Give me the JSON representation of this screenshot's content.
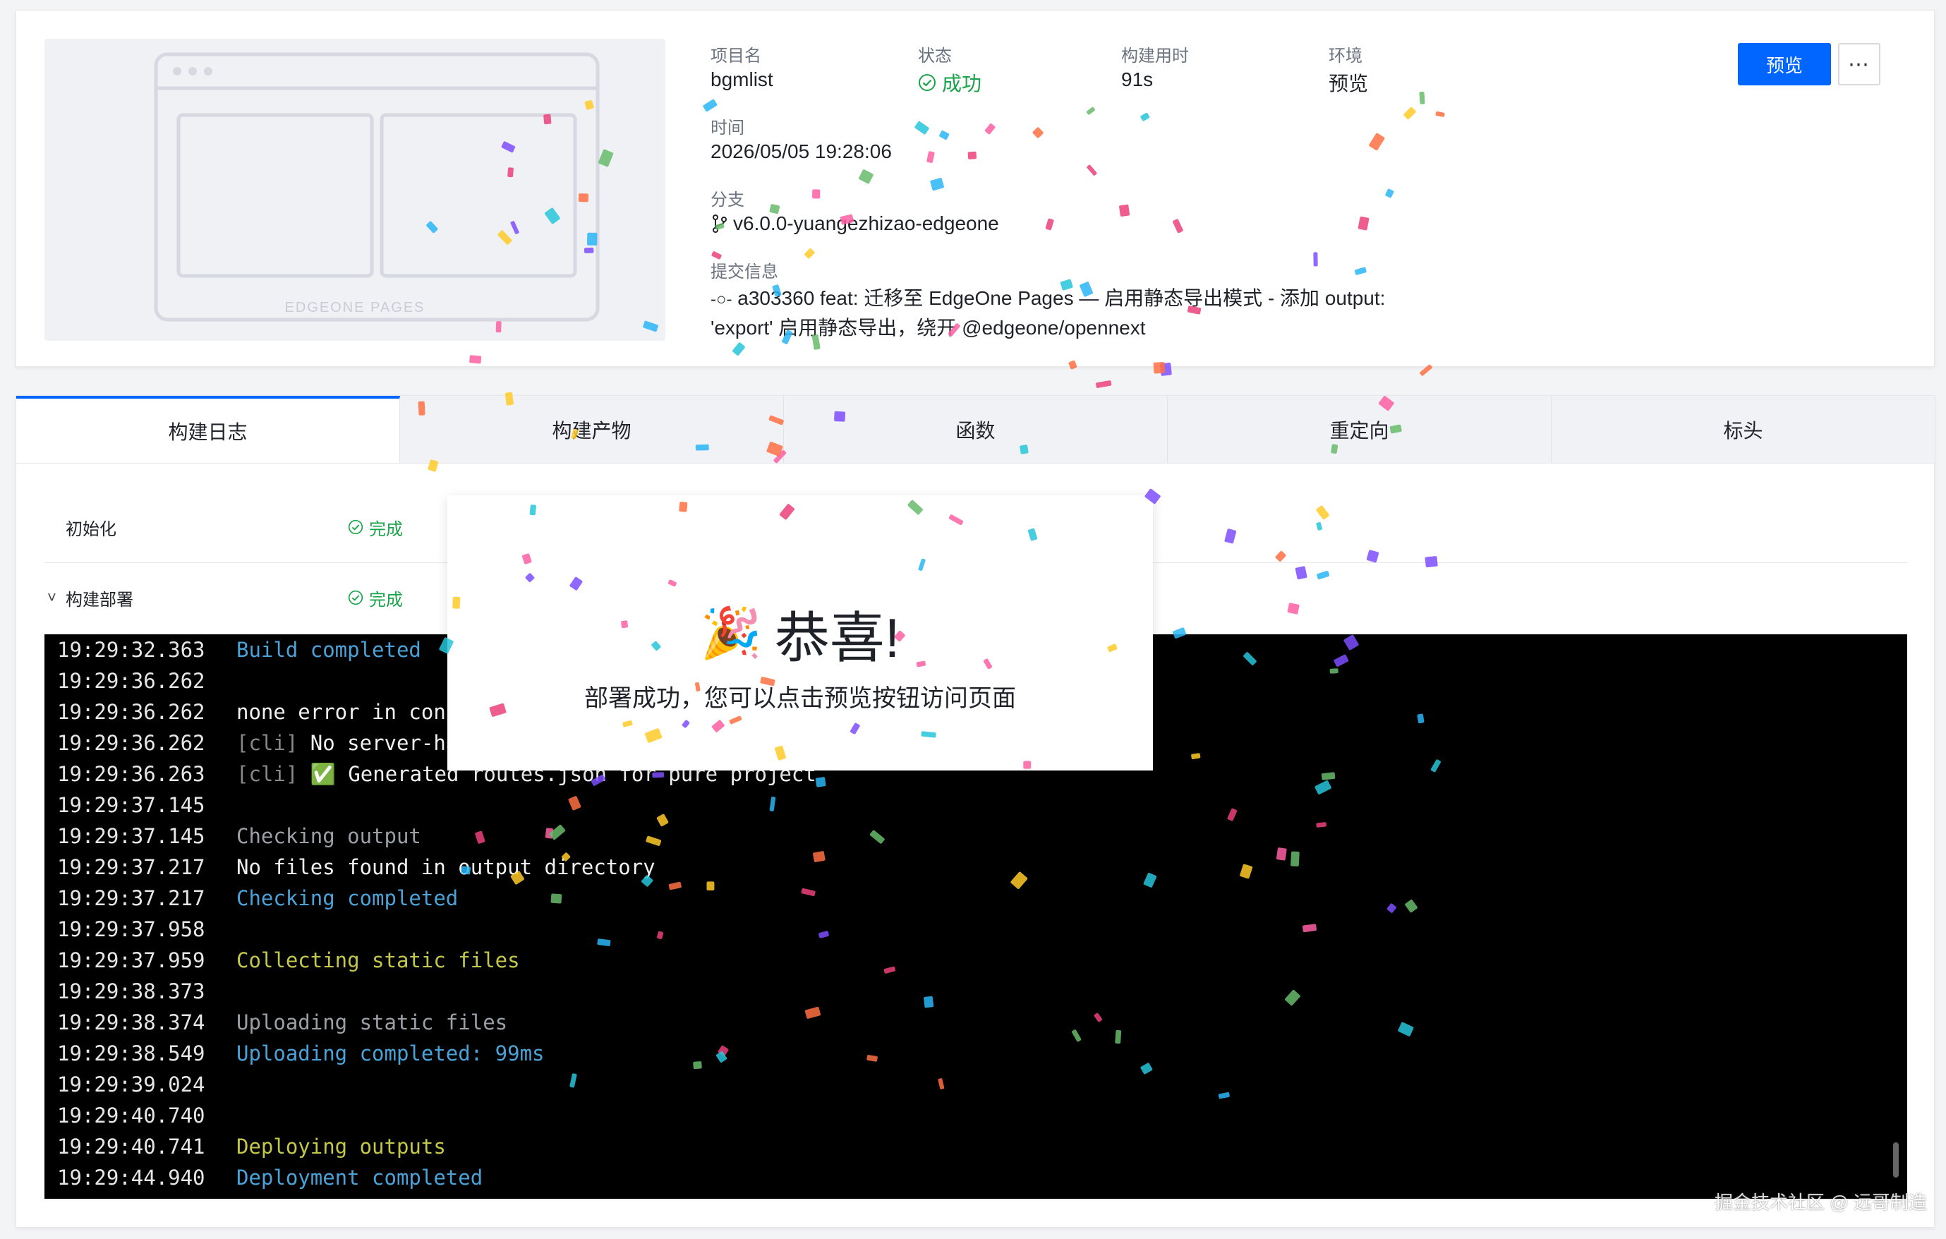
{
  "thumbnail": {
    "label": "EDGEONE PAGES"
  },
  "project": {
    "name_label": "项目名",
    "name": "bgmlist",
    "status_label": "状态",
    "status": "成功",
    "build_time_label": "构建用时",
    "build_time": "91s",
    "env_label": "环境",
    "env": "预览",
    "time_label": "时间",
    "time": "2026/05/05 19:28:06",
    "branch_label": "分支",
    "branch": "v6.0.0-yuangezhizao-edgeone",
    "commit_label": "提交信息",
    "commit": "a303360 feat: 迁移至 EdgeOne Pages — 启用静态导出模式 - 添加 output: 'export' 启用静态导出，绕开 @edgeone/opennext"
  },
  "actions": {
    "preview_label": "预览",
    "more_label": "⋯"
  },
  "tabs": [
    {
      "label": "构建日志",
      "active": true
    },
    {
      "label": "构建产物",
      "active": false
    },
    {
      "label": "函数",
      "active": false
    },
    {
      "label": "重定向",
      "active": false
    },
    {
      "label": "标头",
      "active": false
    }
  ],
  "steps": [
    {
      "name": "初始化",
      "status": "完成"
    },
    {
      "name": "构建部署",
      "status": "完成",
      "chevron": "˅"
    }
  ],
  "logs": [
    {
      "time": "19:29:32.363",
      "prefix": "",
      "text": "Build completed",
      "color": "blue"
    },
    {
      "time": "19:29:36.262",
      "prefix": "",
      "text": "",
      "color": "default"
    },
    {
      "time": "19:29:36.262",
      "prefix": "",
      "text": "none error in con",
      "color": "default"
    },
    {
      "time": "19:29:36.262",
      "prefix": "[cli] ",
      "text": "No server-ha",
      "color": "default"
    },
    {
      "time": "19:29:36.263",
      "prefix": "[cli] ",
      "text": "✅ Generated routes.json for pure project",
      "color": "default"
    },
    {
      "time": "19:29:37.145",
      "prefix": "",
      "text": "",
      "color": "default"
    },
    {
      "time": "19:29:37.145",
      "prefix": "",
      "text": "Checking output",
      "color": "gray"
    },
    {
      "time": "19:29:37.217",
      "prefix": "",
      "text": "No files found in output directory",
      "color": "default"
    },
    {
      "time": "19:29:37.217",
      "prefix": "",
      "text": "Checking completed",
      "color": "blue"
    },
    {
      "time": "19:29:37.958",
      "prefix": "",
      "text": "",
      "color": "default"
    },
    {
      "time": "19:29:37.959",
      "prefix": "",
      "text": "Collecting static files",
      "color": "yellow"
    },
    {
      "time": "19:29:38.373",
      "prefix": "",
      "text": "",
      "color": "default"
    },
    {
      "time": "19:29:38.374",
      "prefix": "",
      "text": "Uploading static files",
      "color": "gray"
    },
    {
      "time": "19:29:38.549",
      "prefix": "",
      "text": "Uploading completed: 99ms",
      "color": "blue"
    },
    {
      "time": "19:29:39.024",
      "prefix": "",
      "text": "",
      "color": "default"
    },
    {
      "time": "19:29:40.740",
      "prefix": "",
      "text": "",
      "color": "default"
    },
    {
      "time": "19:29:40.741",
      "prefix": "",
      "text": "Deploying outputs",
      "color": "yellow"
    },
    {
      "time": "19:29:44.940",
      "prefix": "",
      "text": "Deployment completed",
      "color": "blue"
    }
  ],
  "modal": {
    "emoji": "🎉",
    "title": "恭喜!",
    "subtitle": "部署成功，您可以点击预览按钮访问页面"
  },
  "watermark": "掘金技术社区 @ 远哥制造"
}
